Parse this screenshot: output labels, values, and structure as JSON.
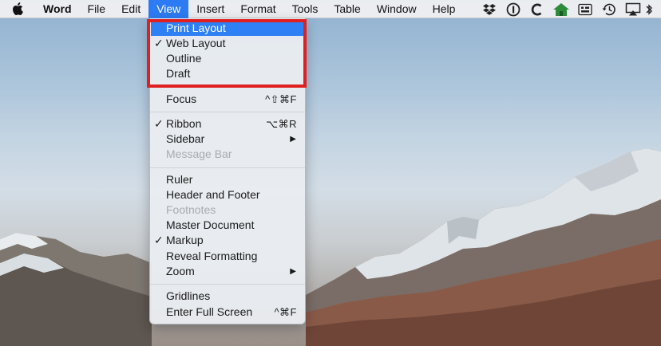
{
  "menubar": {
    "apple_icon": "apple-logo",
    "app_name": "Word",
    "menus": [
      "File",
      "Edit",
      "View",
      "Insert",
      "Format",
      "Tools",
      "Table",
      "Window",
      "Help"
    ],
    "active_menu": "View",
    "status_icons": [
      "dropbox-icon",
      "1password-icon",
      "c-app-icon",
      "house-icon",
      "keyboard-icon",
      "time-machine-icon",
      "airplay-icon",
      "bluetooth-icon"
    ]
  },
  "view_menu": {
    "print_layout": "Print Layout",
    "web_layout": "Web Layout",
    "outline": "Outline",
    "draft": "Draft",
    "focus": "Focus",
    "focus_shortcut": "^⇧⌘F",
    "ribbon": "Ribbon",
    "ribbon_shortcut": "⌥⌘R",
    "sidebar": "Sidebar",
    "message_bar": "Message Bar",
    "ruler": "Ruler",
    "header_footer": "Header and Footer",
    "footnotes": "Footnotes",
    "master_document": "Master Document",
    "markup": "Markup",
    "reveal_formatting": "Reveal Formatting",
    "zoom": "Zoom",
    "gridlines": "Gridlines",
    "full_screen": "Enter Full Screen",
    "full_screen_shortcut": "^⌘F",
    "check_mark": "✓",
    "submenu_arrow": "▶"
  },
  "colors": {
    "menu_highlight": "#2e80f4",
    "annotation_box": "#e02020"
  }
}
